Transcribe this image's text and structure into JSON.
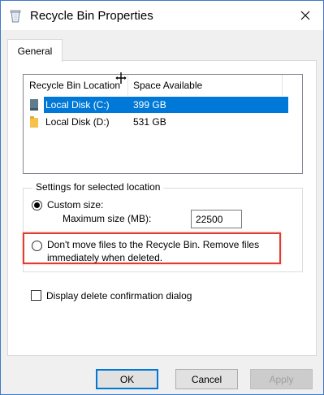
{
  "window": {
    "title": "Recycle Bin Properties",
    "icon": "recycle-bin-icon",
    "accent_color": "#0078d7"
  },
  "tabs": [
    {
      "label": "General",
      "selected": true
    }
  ],
  "location_list": {
    "columns": [
      "Recycle Bin Location",
      "Space Available"
    ],
    "rows": [
      {
        "name": "Local Disk (C:)",
        "space": "399 GB",
        "selected": true,
        "icon": "system-drive-icon"
      },
      {
        "name": "Local Disk (D:)",
        "space": "531 GB",
        "selected": false,
        "icon": "folder-drive-icon"
      }
    ]
  },
  "settings": {
    "group_label": "Settings for selected location",
    "custom_size_label": "Custom size:",
    "custom_size_selected": true,
    "max_size_label": "Maximum size (MB):",
    "max_size_value": "22500",
    "dont_move_line1": "Don't move files to the Recycle Bin. Remove files",
    "dont_move_line2": "immediately when deleted.",
    "dont_move_selected": false,
    "highlight_color": "#e03c31"
  },
  "confirm": {
    "label": "Display delete confirmation dialog",
    "checked": false
  },
  "buttons": {
    "ok": "OK",
    "cancel": "Cancel",
    "apply": "Apply"
  }
}
